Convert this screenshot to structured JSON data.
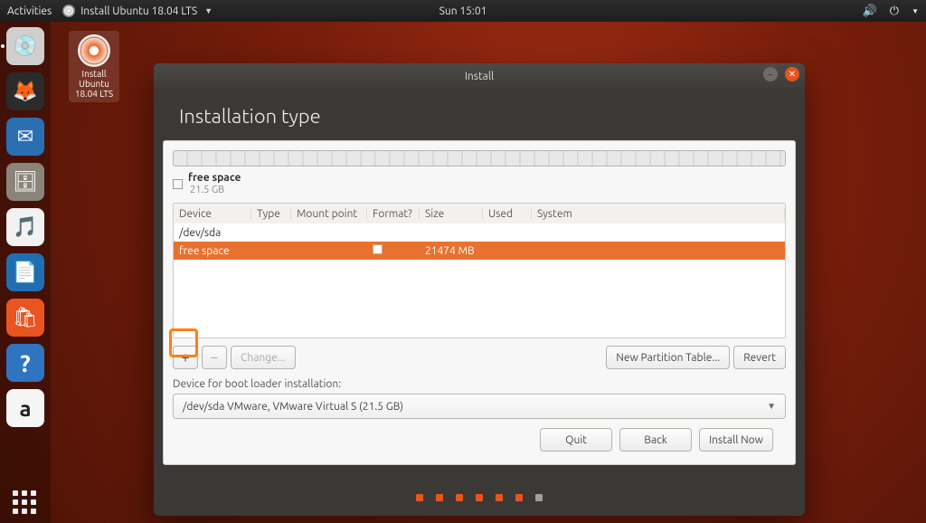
{
  "topbar": {
    "activities": "Activities",
    "app_name": "Install Ubuntu 18.04 LTS",
    "clock": "Sun 15:01"
  },
  "dock": {
    "items": [
      {
        "name": "installer-icon",
        "glyph": "💿",
        "bg": "#d0cfcd",
        "running": true
      },
      {
        "name": "firefox-icon",
        "glyph": "🦊",
        "bg": "#2b2b2b"
      },
      {
        "name": "thunderbird-icon",
        "glyph": "✉",
        "bg": "#2b6fb3"
      },
      {
        "name": "files-icon",
        "glyph": "🗄",
        "bg": "#8a847b"
      },
      {
        "name": "rhythmbox-icon",
        "glyph": "🎵",
        "bg": "#f2f2f2"
      },
      {
        "name": "writer-icon",
        "glyph": "📄",
        "bg": "#1f6fb0"
      },
      {
        "name": "software-icon",
        "glyph": "🛍",
        "bg": "#e95420"
      },
      {
        "name": "help-icon",
        "glyph": "?",
        "bg": "#2f74c0"
      },
      {
        "name": "amazon-icon",
        "glyph": "a",
        "bg": "#f5f5f5"
      }
    ]
  },
  "desktop_icon": {
    "line1": "Install",
    "line2": "Ubuntu",
    "line3": "18.04 LTS"
  },
  "window": {
    "title": "Install",
    "heading": "Installation type",
    "legend_title": "free space",
    "legend_size": "21.5 GB",
    "columns": [
      "Device",
      "Type",
      "Mount point",
      "Format?",
      "Size",
      "Used",
      "System"
    ],
    "rows": [
      {
        "device": "/dev/sda",
        "type": "",
        "mount": "",
        "format": "",
        "size": "",
        "used": "",
        "system": "",
        "selected": false
      },
      {
        "device": "   free space",
        "type": "",
        "mount": "",
        "format": "[ ]",
        "size": "21474 MB",
        "used": "",
        "system": "",
        "selected": true
      }
    ],
    "toolbar": {
      "add": "+",
      "remove": "−",
      "change": "Change...",
      "new_table": "New Partition Table...",
      "revert": "Revert"
    },
    "boot_label": "Device for boot loader installation:",
    "boot_device": "/dev/sda VMware, VMware Virtual S (21.5 GB)",
    "nav": {
      "quit": "Quit",
      "back": "Back",
      "install": "Install Now"
    },
    "progress_total": 7,
    "progress_done": 6
  }
}
